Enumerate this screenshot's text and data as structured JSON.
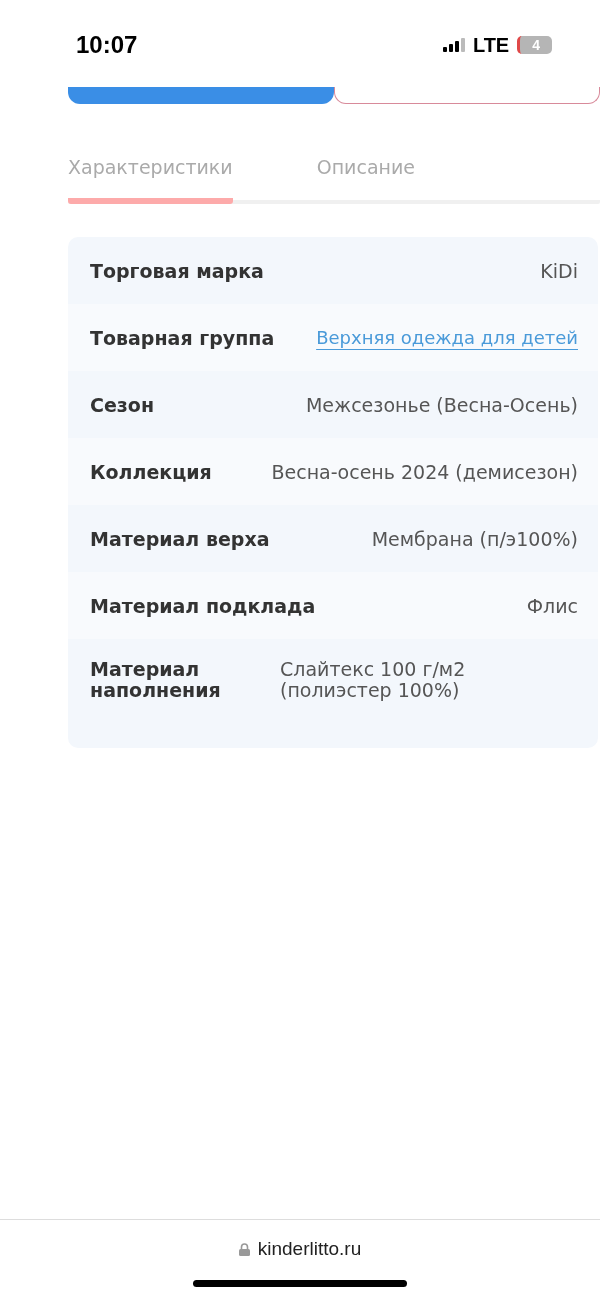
{
  "status_bar": {
    "time": "10:07",
    "network": "LTE",
    "battery": "4"
  },
  "tabs": [
    {
      "label": "Характеристики",
      "selected": true
    },
    {
      "label": "Описание",
      "selected": false
    }
  ],
  "specs": [
    {
      "kind": "text",
      "label": "Торговая марка",
      "value": "KiDi"
    },
    {
      "kind": "link",
      "label": "Товарная группа",
      "value": "Верхняя одежда для детей"
    },
    {
      "kind": "text",
      "label": "Сезон",
      "value": "Межсезонье (Весна-Осень)"
    },
    {
      "kind": "text",
      "label": "Коллекция",
      "value": "Весна-осень 2024 (демисезон)"
    },
    {
      "kind": "text",
      "label": "Материал верха",
      "value": "Мембрана (п/э100%)"
    },
    {
      "kind": "text",
      "label": "Материал подклада",
      "value": "Флис"
    },
    {
      "kind": "wrap",
      "label": "Материал наполнения",
      "value": "Слайтекс 100 г/м2 (полиэстер 100%)"
    }
  ],
  "browser": {
    "url": "kinderlitto.ru"
  }
}
